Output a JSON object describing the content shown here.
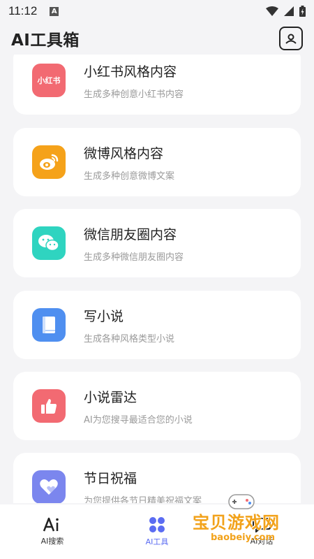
{
  "status_bar": {
    "time": "11:12",
    "notification_letter": "A"
  },
  "header": {
    "title": "AI工具箱",
    "action_icon": "contact-card-icon"
  },
  "tools": [
    {
      "title": "小红书风格内容",
      "desc": "生成多种创意小红书内容",
      "icon": "xiaohongshu-icon",
      "icon_text": "小红书",
      "color": "#f26a72"
    },
    {
      "title": "微博风格内容",
      "desc": "生成多种创意微博文案",
      "icon": "weibo-icon",
      "color": "#f5a21a"
    },
    {
      "title": "微信朋友圈内容",
      "desc": "生成多种微信朋友圈内容",
      "icon": "wechat-icon",
      "color": "#2fd4c0"
    },
    {
      "title": "写小说",
      "desc": "生成各种风格类型小说",
      "icon": "book-icon",
      "color": "#4f8ff0"
    },
    {
      "title": "小说雷达",
      "desc": "AI为您搜寻最适合您的小说",
      "icon": "thumbs-up-icon",
      "color": "#f26a72"
    },
    {
      "title": "节日祝福",
      "desc": "为您提供各节日精美祝福文案",
      "icon": "heart-icon",
      "color": "#7b86ee"
    }
  ],
  "bottom_nav": [
    {
      "label": "AI搜索",
      "icon": "ai-search-icon",
      "active": false
    },
    {
      "label": "AI工具",
      "icon": "ai-tools-icon",
      "active": true
    },
    {
      "label": "AI对话",
      "icon": "ai-chat-icon",
      "active": false
    }
  ],
  "watermark": {
    "title": "宝贝游戏网",
    "url": "baobeiy.com"
  },
  "colors": {
    "accent": "#5b6cf2",
    "background": "#f4f4f6"
  }
}
